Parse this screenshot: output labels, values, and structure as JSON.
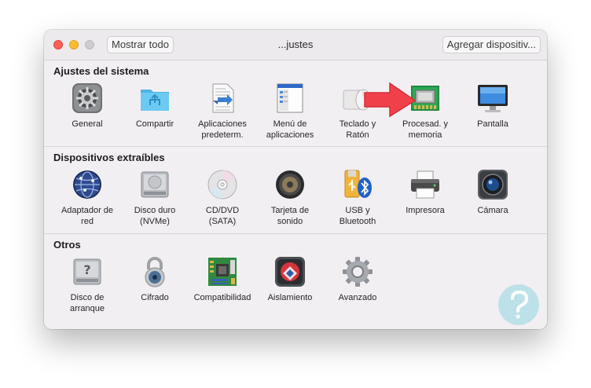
{
  "window": {
    "title": "...justes",
    "show_all_label": "Mostrar todo",
    "add_device_label": "Agregar dispositiv..."
  },
  "sections": [
    {
      "title": "Ajustes del sistema",
      "items": [
        {
          "label": "General",
          "icon": "general-gear-icon"
        },
        {
          "label": "Compartir",
          "icon": "shared-folder-icon"
        },
        {
          "label": "Aplicaciones\npredeterm.",
          "icon": "default-apps-document-icon"
        },
        {
          "label": "Menú de\naplicaciones",
          "icon": "applications-menu-icon"
        },
        {
          "label": "Teclado y\nRatón",
          "icon": "keyboard-mouse-icon"
        },
        {
          "label": "Procesad. y\nmemoria",
          "icon": "memory-chip-icon"
        },
        {
          "label": "Pantalla",
          "icon": "display-monitor-icon"
        }
      ]
    },
    {
      "title": "Dispositivos extraíbles",
      "items": [
        {
          "label": "Adaptador de\nred",
          "icon": "network-globe-icon"
        },
        {
          "label": "Disco duro\n(NVMe)",
          "icon": "hard-drive-icon"
        },
        {
          "label": "CD/DVD\n(SATA)",
          "icon": "optical-disc-icon"
        },
        {
          "label": "Tarjeta de\nsonido",
          "icon": "speaker-icon"
        },
        {
          "label": "USB y\nBluetooth",
          "icon": "usb-bluetooth-icon"
        },
        {
          "label": "Impresora",
          "icon": "printer-icon"
        },
        {
          "label": "Cámara",
          "icon": "camera-icon"
        }
      ]
    },
    {
      "title": "Otros",
      "items": [
        {
          "label": "Disco de\narranque",
          "icon": "startup-disk-icon"
        },
        {
          "label": "Cifrado",
          "icon": "padlock-icon"
        },
        {
          "label": "Compatibilidad",
          "icon": "motherboard-icon"
        },
        {
          "label": "Aislamiento",
          "icon": "isolation-icon"
        },
        {
          "label": "Avanzado",
          "icon": "advanced-gear-icon"
        }
      ]
    }
  ],
  "colors": {
    "arrow": "#f0414a",
    "traffic_close": "#fe5f57",
    "traffic_minimize": "#febc2e",
    "watermark": "#5bc8d6"
  }
}
